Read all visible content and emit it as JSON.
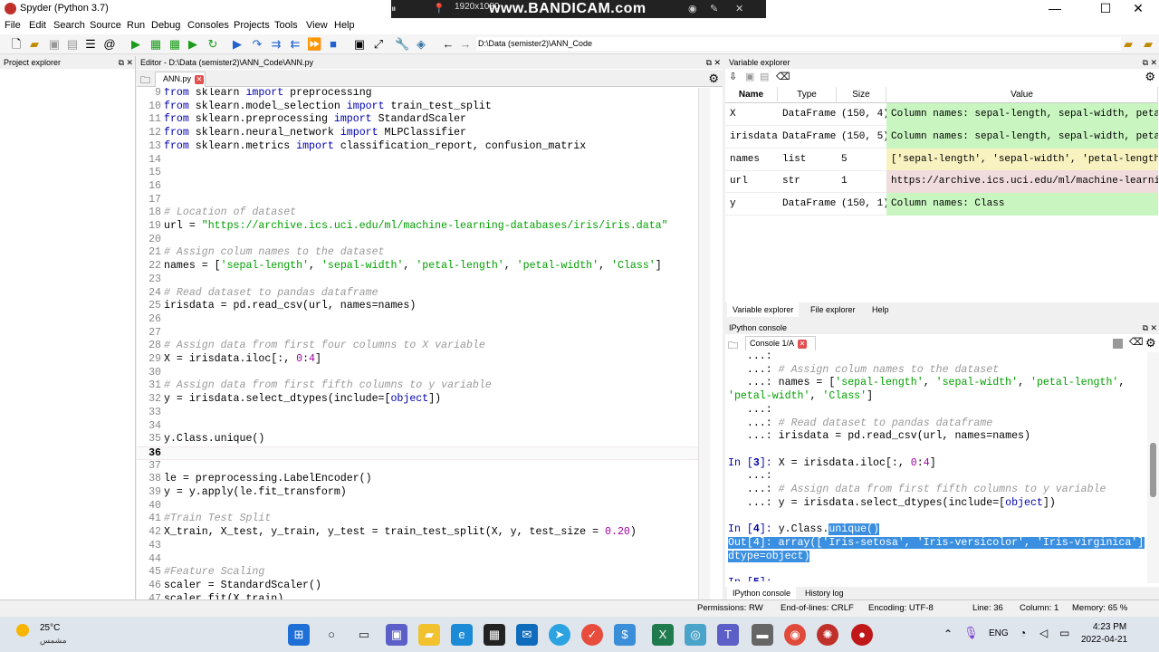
{
  "window": {
    "title": "Spyder (Python 3.7)"
  },
  "recording_overlay": {
    "resolution": "1920x1080",
    "brand": "www.BANDICAM.com"
  },
  "menu": [
    "File",
    "Edit",
    "Search",
    "Source",
    "Run",
    "Debug",
    "Consoles",
    "Projects",
    "Tools",
    "View",
    "Help"
  ],
  "toolbar": {
    "path": "D:\\Data (semister2)\\ANN_Code"
  },
  "panes": {
    "project_explorer": "Project explorer",
    "editor": "Editor - D:\\Data (semister2)\\ANN_Code\\ANN.py",
    "editor_tab": "ANN.py",
    "variable_explorer": "Variable explorer",
    "ipython_console": "IPython console",
    "console_tab": "Console 1/A"
  },
  "editor": {
    "current_line": 36,
    "lines": [
      {
        "n": "9",
        "segs": [
          [
            "kw",
            "from"
          ],
          [
            "t",
            " sklearn "
          ],
          [
            "kw",
            "import"
          ],
          [
            "t",
            " preprocessing"
          ]
        ]
      },
      {
        "n": "10",
        "segs": [
          [
            "kw",
            "from"
          ],
          [
            "t",
            " sklearn.model_selection "
          ],
          [
            "kw",
            "import"
          ],
          [
            "t",
            " train_test_split"
          ]
        ]
      },
      {
        "n": "11",
        "segs": [
          [
            "kw",
            "from"
          ],
          [
            "t",
            " sklearn.preprocessing "
          ],
          [
            "kw",
            "import"
          ],
          [
            "t",
            " StandardScaler"
          ]
        ]
      },
      {
        "n": "12",
        "segs": [
          [
            "kw",
            "from"
          ],
          [
            "t",
            " sklearn.neural_network "
          ],
          [
            "kw",
            "import"
          ],
          [
            "t",
            " MLPClassifier"
          ]
        ]
      },
      {
        "n": "13",
        "segs": [
          [
            "kw",
            "from"
          ],
          [
            "t",
            " sklearn.metrics "
          ],
          [
            "kw",
            "import"
          ],
          [
            "t",
            " classification_report, confusion_matrix"
          ]
        ]
      },
      {
        "n": "14",
        "segs": []
      },
      {
        "n": "15",
        "segs": []
      },
      {
        "n": "16",
        "segs": []
      },
      {
        "n": "17",
        "segs": []
      },
      {
        "n": "18",
        "segs": [
          [
            "cm",
            "# Location of dataset"
          ]
        ]
      },
      {
        "n": "19",
        "segs": [
          [
            "t",
            "url = "
          ],
          [
            "str",
            "\"https://archive.ics.uci.edu/ml/machine-learning-databases/iris/iris.data\""
          ]
        ]
      },
      {
        "n": "20",
        "segs": []
      },
      {
        "n": "21",
        "segs": [
          [
            "cm",
            "# Assign colum names to the dataset"
          ]
        ]
      },
      {
        "n": "22",
        "segs": [
          [
            "t",
            "names = ["
          ],
          [
            "str",
            "'sepal-length'"
          ],
          [
            "t",
            ", "
          ],
          [
            "str",
            "'sepal-width'"
          ],
          [
            "t",
            ", "
          ],
          [
            "str",
            "'petal-length'"
          ],
          [
            "t",
            ", "
          ],
          [
            "str",
            "'petal-width'"
          ],
          [
            "t",
            ", "
          ],
          [
            "str",
            "'Class'"
          ],
          [
            "t",
            "]"
          ]
        ]
      },
      {
        "n": "23",
        "segs": []
      },
      {
        "n": "24",
        "segs": [
          [
            "cm",
            "# Read dataset to pandas dataframe"
          ]
        ]
      },
      {
        "n": "25",
        "segs": [
          [
            "t",
            "irisdata = pd.read_csv(url, names=names)"
          ]
        ]
      },
      {
        "n": "26",
        "segs": []
      },
      {
        "n": "27",
        "segs": []
      },
      {
        "n": "28",
        "segs": [
          [
            "cm",
            "# Assign data from first four columns to X variable"
          ]
        ]
      },
      {
        "n": "29",
        "segs": [
          [
            "t",
            "X = irisdata.iloc[:, "
          ],
          [
            "num",
            "0"
          ],
          [
            "t",
            ":"
          ],
          [
            "num",
            "4"
          ],
          [
            "t",
            "]"
          ]
        ]
      },
      {
        "n": "30",
        "segs": []
      },
      {
        "n": "31",
        "segs": [
          [
            "cm",
            "# Assign data from first fifth columns to y variable"
          ]
        ]
      },
      {
        "n": "32",
        "segs": [
          [
            "t",
            "y = irisdata.select_dtypes(include=["
          ],
          [
            "kw",
            "object"
          ],
          [
            "t",
            "])"
          ]
        ]
      },
      {
        "n": "33",
        "segs": []
      },
      {
        "n": "34",
        "segs": []
      },
      {
        "n": "35",
        "segs": [
          [
            "t",
            "y.Class.unique()"
          ]
        ]
      },
      {
        "n": "36",
        "segs": []
      },
      {
        "n": "37",
        "segs": []
      },
      {
        "n": "38",
        "segs": [
          [
            "t",
            "le = preprocessing.LabelEncoder()"
          ]
        ]
      },
      {
        "n": "39",
        "segs": [
          [
            "t",
            "y = y.apply(le.fit_transform)"
          ]
        ]
      },
      {
        "n": "40",
        "segs": []
      },
      {
        "n": "41",
        "segs": [
          [
            "cm",
            "#Train Test Split"
          ]
        ]
      },
      {
        "n": "42",
        "segs": [
          [
            "t",
            "X_train, X_test, y_train, y_test = train_test_split(X, y, test_size = "
          ],
          [
            "num",
            "0.20"
          ],
          [
            "t",
            ")"
          ]
        ]
      },
      {
        "n": "43",
        "segs": []
      },
      {
        "n": "44",
        "segs": []
      },
      {
        "n": "45",
        "segs": [
          [
            "cm",
            "#Feature Scaling"
          ]
        ]
      },
      {
        "n": "46",
        "segs": [
          [
            "t",
            "scaler = StandardScaler()"
          ]
        ]
      },
      {
        "n": "47",
        "segs": [
          [
            "t",
            "scaler.fit(X_train)"
          ]
        ]
      }
    ]
  },
  "variables": {
    "headers": [
      "Name",
      "Type",
      "Size",
      "Value"
    ],
    "rows": [
      {
        "name": "X",
        "type": "DataFrame",
        "size": "(150, 4)",
        "value": "Column names: sepal-length, sepal-width, petal-…",
        "color": "#c8f5c0"
      },
      {
        "name": "irisdata",
        "type": "DataFrame",
        "size": "(150, 5)",
        "value": "Column names: sepal-length, sepal-width, petal-…",
        "color": "#c8f5c0"
      },
      {
        "name": "names",
        "type": "list",
        "size": "5",
        "value": "['sepal-length', 'sepal-width', 'petal-length',…",
        "color": "#f8f2c0"
      },
      {
        "name": "url",
        "type": "str",
        "size": "1",
        "value": "https://archive.ics.uci.edu/ml/machine-learning…",
        "color": "#f0dcdc"
      },
      {
        "name": "y",
        "type": "DataFrame",
        "size": "(150, 1)",
        "value": "Column names: Class",
        "color": "#c8f5c0"
      }
    ]
  },
  "ve_tabs": [
    "Variable explorer",
    "File explorer",
    "Help"
  ],
  "console": {
    "lines": [
      {
        "segs": [
          [
            "t",
            "   ...: "
          ]
        ]
      },
      {
        "segs": [
          [
            "t",
            "   ...: "
          ],
          [
            "cm",
            "# Assign colum names to the dataset"
          ]
        ]
      },
      {
        "segs": [
          [
            "t",
            "   ...: names = ["
          ],
          [
            "str",
            "'sepal-length'"
          ],
          [
            "t",
            ", "
          ],
          [
            "str",
            "'sepal-width'"
          ],
          [
            "t",
            ", "
          ],
          [
            "str",
            "'petal-length'"
          ],
          [
            "t",
            ","
          ]
        ]
      },
      {
        "segs": [
          [
            "str",
            "'petal-width'"
          ],
          [
            "t",
            ", "
          ],
          [
            "str",
            "'Class'"
          ],
          [
            "t",
            "]"
          ]
        ]
      },
      {
        "segs": [
          [
            "t",
            "   ...: "
          ]
        ]
      },
      {
        "segs": [
          [
            "t",
            "   ...: "
          ],
          [
            "cm",
            "# Read dataset to pandas dataframe"
          ]
        ]
      },
      {
        "segs": [
          [
            "t",
            "   ...: irisdata = pd.read_csv(url, names=names)"
          ]
        ]
      },
      {
        "segs": []
      },
      {
        "segs": [
          [
            "in",
            "In ["
          ],
          [
            "inb",
            "3"
          ],
          [
            "in",
            "]: "
          ],
          [
            "t",
            "X = irisdata.iloc[:, "
          ],
          [
            "num",
            "0"
          ],
          [
            "t",
            ":"
          ],
          [
            "num",
            "4"
          ],
          [
            "t",
            "]"
          ]
        ]
      },
      {
        "segs": [
          [
            "t",
            "   ...: "
          ]
        ]
      },
      {
        "segs": [
          [
            "t",
            "   ...: "
          ],
          [
            "cm",
            "# Assign data from first fifth columns to y variable"
          ]
        ]
      },
      {
        "segs": [
          [
            "t",
            "   ...: y = irisdata.select_dtypes(include=["
          ],
          [
            "kw",
            "object"
          ],
          [
            "t",
            "])"
          ]
        ]
      },
      {
        "segs": []
      },
      {
        "segs": [
          [
            "in",
            "In ["
          ],
          [
            "inb",
            "4"
          ],
          [
            "in",
            "]: "
          ],
          [
            "t",
            "y.Class."
          ],
          [
            "sel",
            "unique()"
          ]
        ]
      },
      {
        "segs": [
          [
            "sel",
            "Out[4]: array(['Iris-setosa', 'Iris-versicolor', 'Iris-virginica'],"
          ]
        ]
      },
      {
        "segs": [
          [
            "sel",
            "dtype=object)"
          ]
        ]
      },
      {
        "segs": []
      },
      {
        "segs": [
          [
            "in",
            "In ["
          ],
          [
            "inb",
            "5"
          ],
          [
            "in",
            "]: "
          ]
        ]
      }
    ]
  },
  "console_tabs": [
    "IPython console",
    "History log"
  ],
  "status": {
    "permissions": "Permissions: RW",
    "eol": "End-of-lines: CRLF",
    "encoding": "Encoding: UTF-8",
    "line": "Line: 36",
    "column": "Column: 1",
    "memory": "Memory:  65 %"
  },
  "taskbar": {
    "weather_temp": "25°C",
    "weather_desc": "مشمس",
    "lang": "ENG",
    "time": "4:23 PM",
    "date": "2022-04-21"
  }
}
